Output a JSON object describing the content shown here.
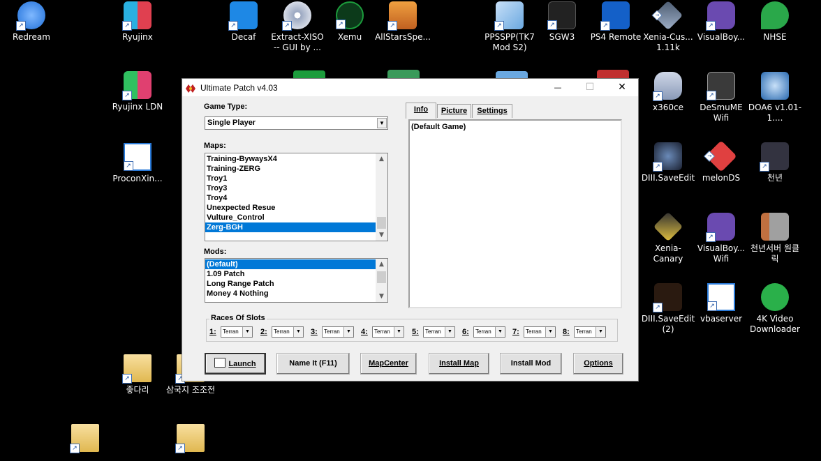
{
  "desktop": {
    "icons": [
      {
        "label": "Redream",
        "color": "#1f6fd8"
      },
      {
        "label": "Ryujinx",
        "color": "#e04050"
      },
      {
        "label": "Decaf",
        "color": "#1e88e5"
      },
      {
        "label": "Extract-XISO -- GUI by ...",
        "color": "#9aa7c0"
      },
      {
        "label": "Xemu",
        "color": "#1c9c3c"
      },
      {
        "label": "AllStarsSpe...",
        "color": "#f0a040"
      },
      {
        "label": "PPSSPP(TK7 Mod S2)",
        "color": "#6aa8e0"
      },
      {
        "label": "SGW3",
        "color": "#222222"
      },
      {
        "label": "PS4 Remote",
        "color": "#1460c8"
      },
      {
        "label": "Xenia-Cus... 1.11k",
        "color": "#7a8aa0"
      },
      {
        "label": "VisualBoy...",
        "color": "#6a4ab0"
      },
      {
        "label": "NHSE",
        "color": "#2aa84a"
      },
      {
        "label": "Ryujinx LDN",
        "color": "#30c060"
      },
      {
        "label": "x360ce",
        "color": "#8a9ab8"
      },
      {
        "label": "DeSmuME Wifi",
        "color": "#3a3a3a"
      },
      {
        "label": "DOA6 v1.01-1....",
        "color": "#2a6ab0"
      },
      {
        "label": "ProconXin...",
        "color": "#2a7ad8"
      },
      {
        "label": "DIII.SaveEdit",
        "color": "#2a3a5a"
      },
      {
        "label": "melonDS",
        "color": "#e04040"
      },
      {
        "label": "천년",
        "color": "#333340"
      },
      {
        "label": "Xenia-Canary",
        "color": "#606060"
      },
      {
        "label": "VisualBoy... Wifi",
        "color": "#6a4ab0"
      },
      {
        "label": "천년서버 원클릭",
        "color": "#b06040"
      },
      {
        "label": "DIII.SaveEdit (2)",
        "color": "#4a2a1a"
      },
      {
        "label": "vbaserver",
        "color": "#2a7ad8"
      },
      {
        "label": "4K Video Downloader",
        "color": "#2ab04a"
      },
      {
        "label": "좋다리",
        "color": "#e8c870"
      },
      {
        "label": "삼국지 조조전",
        "color": "#e8c870"
      },
      {
        "label": "",
        "color": "#e8c870"
      },
      {
        "label": "",
        "color": "#e8c870"
      }
    ]
  },
  "window": {
    "title": "Ultimate Patch v4.03",
    "minimize_icon": "minimize-icon",
    "maximize_icon": "maximize-icon",
    "close_icon": "close-icon",
    "controls": {
      "minimize": "—",
      "maximize": "☐",
      "close": "✕"
    }
  },
  "game_type": {
    "label": "Game Type:",
    "value": "Single Player"
  },
  "maps": {
    "label": "Maps:",
    "items": [
      "Training-BywaysX4",
      "Training-ZERG",
      "Troy1",
      "Troy3",
      "Troy4",
      "Unexpected Resue",
      "Vulture_Control",
      "Zerg-BGH"
    ],
    "selected": "Zerg-BGH"
  },
  "mods": {
    "label": "Mods:",
    "items": [
      "(Default)",
      "1.09 Patch",
      "Long Range Patch",
      "Money 4 Nothing"
    ],
    "selected": "(Default)"
  },
  "tabs": {
    "info": "Info",
    "picture": "Picture",
    "settings": "Settings"
  },
  "info_text": "(Default Game)",
  "races": {
    "label": "Races Of Slots",
    "slots": [
      {
        "num": "1:",
        "race": "Terran"
      },
      {
        "num": "2:",
        "race": "Terran"
      },
      {
        "num": "3:",
        "race": "Terran"
      },
      {
        "num": "4:",
        "race": "Terran"
      },
      {
        "num": "5:",
        "race": "Terran"
      },
      {
        "num": "6:",
        "race": "Terran"
      },
      {
        "num": "7:",
        "race": "Terran"
      },
      {
        "num": "8:",
        "race": "Terran"
      }
    ]
  },
  "buttons": {
    "launch": "Launch",
    "name_it": "Name It (F11)",
    "mapcenter": "MapCenter",
    "install_map": "Install Map",
    "install_mod": "Install Mod",
    "options": "Options"
  }
}
